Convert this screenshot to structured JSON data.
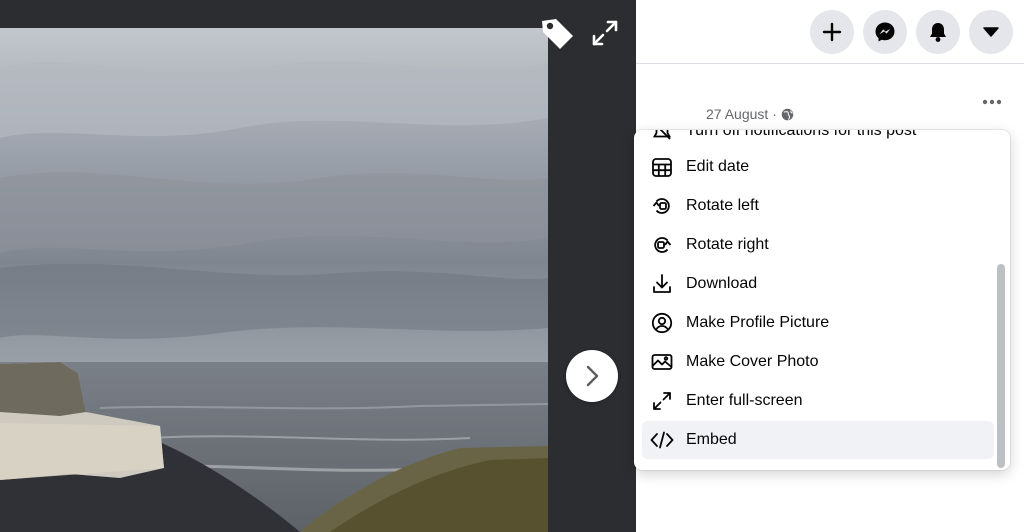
{
  "post": {
    "date": "27 August",
    "separator": "·"
  },
  "menu": {
    "items": [
      {
        "label": "Turn off notifications for this post",
        "icon": "bell-off-icon"
      },
      {
        "label": "Edit date",
        "icon": "calendar-icon"
      },
      {
        "label": "Rotate left",
        "icon": "rotate-left-icon"
      },
      {
        "label": "Rotate right",
        "icon": "rotate-right-icon"
      },
      {
        "label": "Download",
        "icon": "download-icon"
      },
      {
        "label": "Make Profile Picture",
        "icon": "profile-picture-icon"
      },
      {
        "label": "Make Cover Photo",
        "icon": "cover-photo-icon"
      },
      {
        "label": "Enter full-screen",
        "icon": "expand-icon"
      },
      {
        "label": "Embed",
        "icon": "code-icon"
      }
    ]
  },
  "colors": {
    "viewer_background": "#2c2d30",
    "button_background": "#e4e6eb",
    "menu_highlight": "#f0f2f5"
  }
}
